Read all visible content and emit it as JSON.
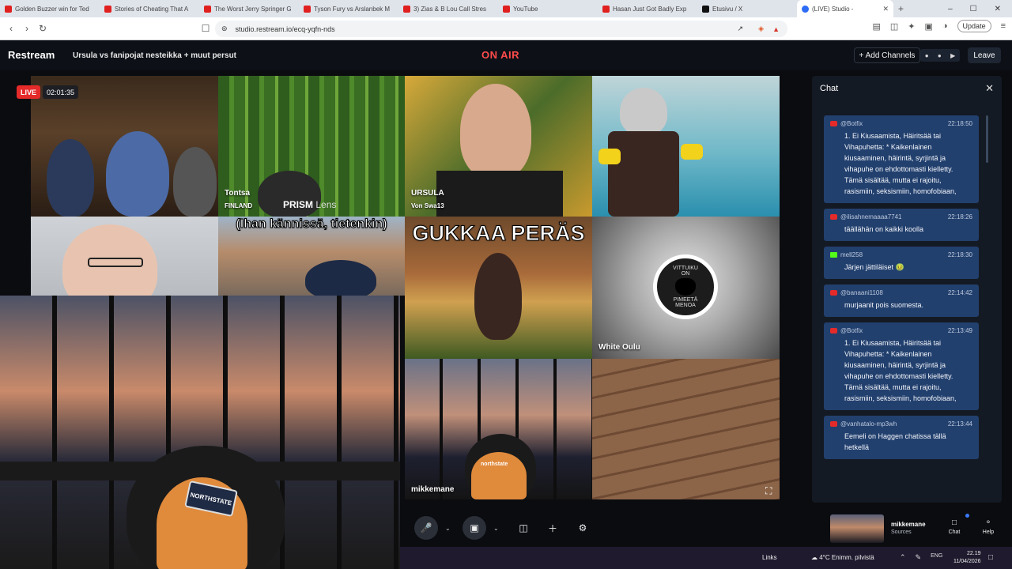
{
  "browser": {
    "tabs": [
      {
        "label": "Golden Buzzer win for Ted",
        "icon": "youtube-icon"
      },
      {
        "label": "Stories of Cheating That A",
        "icon": "youtube-icon"
      },
      {
        "label": "The Worst Jerry Springer G",
        "icon": "youtube-icon"
      },
      {
        "label": "Tyson Fury vs Arslanbek M",
        "icon": "youtube-icon"
      },
      {
        "label": "3) Zias & B Lou Call Stres",
        "icon": "youtube-icon"
      },
      {
        "label": "YouTube",
        "icon": "youtube-icon"
      },
      {
        "label": "Hasan Just Got Badly Exp",
        "icon": "youtube-icon"
      },
      {
        "label": "Etusivu / X",
        "icon": "x-icon"
      },
      {
        "label": "(LIVE) Studio -",
        "icon": "restream-icon"
      }
    ],
    "url": "studio.restream.io/ecq-yqfn-nds",
    "update_label": "Update"
  },
  "studio": {
    "logo": "Restream",
    "title": "Ursula vs fanipojat nesteikka + muut persut",
    "on_air": "ON AIR",
    "add_channels": "+ Add Channels",
    "leave": "Leave",
    "live_badge": "LIVE",
    "live_time": "02:01:35"
  },
  "tiles": {
    "tontsa": {
      "name": "Tontsa",
      "sub": "FINLAND",
      "brand": "PRISM",
      "brand_suffix": "Lens"
    },
    "ursula": {
      "name": "URSULA",
      "sub": "Von Swa13"
    },
    "overlay_top": "(Ihan kännissä, tietenkin)",
    "overlay_mid": "GUKKAA PERÄS",
    "white_oulu": {
      "name": "White Oulu",
      "logo_line1": "VITTUIKU",
      "logo_line2": "ON",
      "logo_line3": "PIMEETÄ",
      "logo_line4": "MENOA"
    },
    "mikkemane": {
      "name": "mikkemane"
    },
    "cap_text": "NORTHSTATE",
    "cap_text_small": "northstate"
  },
  "chat": {
    "title": "Chat",
    "messages": [
      {
        "platform": "youtube",
        "user": "@Botfix",
        "time": "22:18:50",
        "text": "1. Ei Kiusaamista, Häiritsää tai Vihapuhetta: * Kaikenlainen kiusaaminen, häirintä, syrjintä ja vihapuhe on ehdottomasti kielletty. Tämä sisältää, mutta ei rajoitu, rasismiin, seksismiin, homofobiaan,"
      },
      {
        "platform": "youtube",
        "user": "@ilisahnemaaaa7741",
        "time": "22:18:26",
        "text": "täällähän on kaikki koolla"
      },
      {
        "platform": "kick",
        "user": "mell258",
        "time": "22:18:30",
        "text": "Järjen jättiläiset 🤢"
      },
      {
        "platform": "youtube",
        "user": "@banaani1108",
        "time": "22:14:42",
        "text": "murjaanit pois suomesta."
      },
      {
        "platform": "youtube",
        "user": "@Botfix",
        "time": "22:13:49",
        "text": "1. Ei Kiusaamista, Häiritsää tai Vihapuhetta: * Kaikenlainen kiusaaminen, häirintä, syrjintä ja vihapuhe on ehdottomasti kielletty. Tämä sisältää, mutta ei rajoitu, rasismiin, seksismiin, homofobiaan,"
      },
      {
        "platform": "youtube",
        "user": "@vanhatalo-mp3wh",
        "time": "22:13:44",
        "text": "Eemeli on Haggen chatissa tällä hetkellä"
      }
    ]
  },
  "controls": {
    "source_name": "mikkemane",
    "source_label": "Sources",
    "chat_label": "Chat",
    "help_label": "Help"
  },
  "taskbar": {
    "links": "Links",
    "weather": "4°C  Enimm. pilvistä",
    "lang": "ENG",
    "time": "22.19",
    "date": "11/04/2026"
  }
}
